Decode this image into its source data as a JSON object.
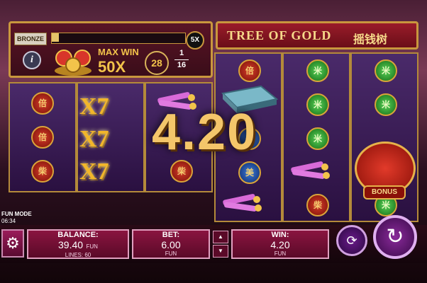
{
  "game": {
    "title": "TREE OF GOLD",
    "title_chinese": "摇钱树",
    "colors": {
      "gold": "#f2c34a",
      "panel": "#8a1440",
      "reel_bg": "#3a1a55"
    }
  },
  "top_panel": {
    "level_badge": "BRONZE",
    "multiplier_badge": "5X",
    "info_icon": "info-icon",
    "max_win_label": "MAX WIN",
    "max_win_value": "50X",
    "spins_current": "28",
    "spins_fraction_top": "1",
    "spins_fraction_bottom": "16"
  },
  "reels": {
    "symbol_glyph_red": "倍",
    "symbol_glyph_blue": "美",
    "symbol_glyph_green": "米",
    "symbol_glyph_red_alt": "柴",
    "wild_seven": "X7",
    "bonus_label": "BONUS"
  },
  "win_overlay": {
    "amount": "4.20"
  },
  "status": {
    "mode": "FUN MODE",
    "clock": "06:34"
  },
  "bottom_bar": {
    "balance_label": "BALANCE:",
    "balance_value": "39.40",
    "balance_currency": "FUN",
    "lines_text": "LINES: 60",
    "bet_label": "BET:",
    "bet_value": "6.00",
    "bet_currency": "FUN",
    "bet_up": "▲",
    "bet_down": "▼",
    "win_label": "WIN:",
    "win_value": "4.20",
    "win_currency": "FUN",
    "settings_icon": "gear-icon",
    "autoplay_icon": "autoplay-icon",
    "spin_icon": "spin-icon"
  }
}
